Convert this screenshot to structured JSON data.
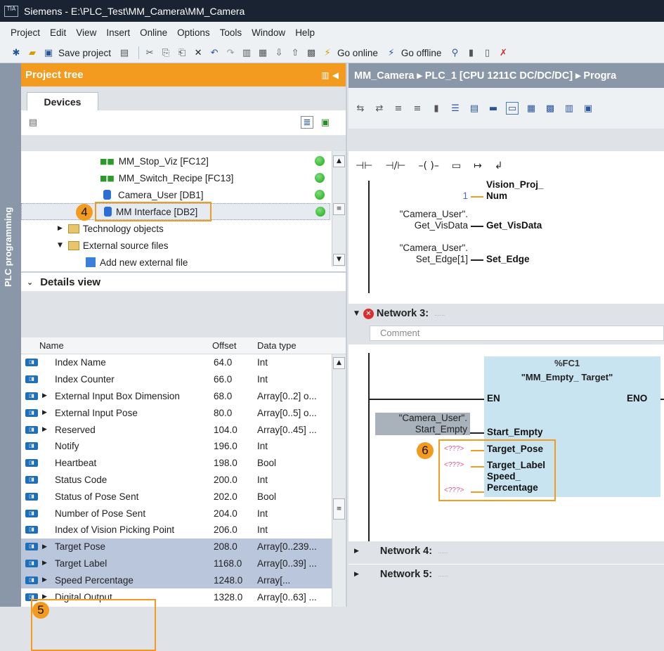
{
  "window": {
    "title": "Siemens - E:\\PLC_Test\\MM_Camera\\MM_Camera",
    "logo": "TIA"
  },
  "menu": [
    "Project",
    "Edit",
    "View",
    "Insert",
    "Online",
    "Options",
    "Tools",
    "Window",
    "Help"
  ],
  "toolbar": {
    "save": "Save project",
    "go_online": "Go online",
    "go_offline": "Go offline"
  },
  "sidebar": {
    "label": "PLC programming"
  },
  "project_tree": {
    "title": "Project tree",
    "tab": "Devices",
    "items": [
      {
        "label": "MM_Stop_Viz [FC12]",
        "icon": "fc-block-icon",
        "status": "green"
      },
      {
        "label": "MM_Switch_Recipe [FC13]",
        "icon": "fc-block-icon",
        "status": "green"
      },
      {
        "label": "Camera_User [DB1]",
        "icon": "db-icon",
        "status": "green"
      },
      {
        "label": "MM Interface [DB2]",
        "icon": "db-icon",
        "status": "green"
      },
      {
        "label": "Technology objects",
        "icon": "folder-icon"
      },
      {
        "label": "External source files",
        "icon": "folder-icon"
      },
      {
        "label": "Add new external file",
        "icon": "add-file-icon"
      }
    ],
    "badge": "4"
  },
  "details_view": {
    "title": "Details view",
    "columns": [
      "Name",
      "Offset",
      "Data type"
    ],
    "rows": [
      {
        "name": "Index Name",
        "offset": "64.0",
        "type": "Int",
        "expand": false,
        "sel": false
      },
      {
        "name": "Index Counter",
        "offset": "66.0",
        "type": "Int",
        "expand": false,
        "sel": false
      },
      {
        "name": "External Input Box Dimension",
        "offset": "68.0",
        "type": "Array[0..2] o...",
        "expand": true,
        "sel": false
      },
      {
        "name": "External Input Pose",
        "offset": "80.0",
        "type": "Array[0..5] o...",
        "expand": true,
        "sel": false
      },
      {
        "name": "Reserved",
        "offset": "104.0",
        "type": "Array[0..45] ...",
        "expand": true,
        "sel": false
      },
      {
        "name": "Notify",
        "offset": "196.0",
        "type": "Int",
        "expand": false,
        "sel": false
      },
      {
        "name": "Heartbeat",
        "offset": "198.0",
        "type": "Bool",
        "expand": false,
        "sel": false
      },
      {
        "name": "Status Code",
        "offset": "200.0",
        "type": "Int",
        "expand": false,
        "sel": false
      },
      {
        "name": "Status of Pose Sent",
        "offset": "202.0",
        "type": "Bool",
        "expand": false,
        "sel": false
      },
      {
        "name": "Number of Pose Sent",
        "offset": "204.0",
        "type": "Int",
        "expand": false,
        "sel": false
      },
      {
        "name": "Index of Vision Picking Point",
        "offset": "206.0",
        "type": "Int",
        "expand": false,
        "sel": false
      },
      {
        "name": "Target Pose",
        "offset": "208.0",
        "type": "Array[0..239...",
        "expand": true,
        "sel": true
      },
      {
        "name": "Target Label",
        "offset": "1168.0",
        "type": "Array[0..39] ...",
        "expand": true,
        "sel": true
      },
      {
        "name": "Speed Percentage",
        "offset": "1248.0",
        "type": "Array[...",
        "expand": true,
        "sel": true
      },
      {
        "name": "Digital Output",
        "offset": "1328.0",
        "type": "Array[0..63] ...",
        "expand": true,
        "sel": false
      }
    ],
    "badge": "5"
  },
  "editor": {
    "breadcrumb": "MM_Camera ▸ PLC_1 [CPU 1211C DC/DC/DC] ▸ Progra",
    "upper": {
      "const_val": "1",
      "pin1a": "Vision_Proj_",
      "pin1b": "Num",
      "tag2a": "\"Camera_User\".",
      "tag2b": "Get_VisData",
      "pin2": "Get_VisData",
      "tag3a": "\"Camera_User\".",
      "tag3b": "Set_Edge[1]",
      "pin3": "Set_Edge"
    },
    "network3": {
      "label": "Network 3:",
      "comment": "Comment",
      "block_no": "%FC1",
      "block_name": "\"MM_Empty_ Target\"",
      "en": "EN",
      "eno": "ENO",
      "tag_a": "\"Camera_User\".",
      "tag_b": "Start_Empty",
      "pin_start": "Start_Empty",
      "pin_pose": "Target_Pose",
      "pin_label": "Target_Label",
      "pin_speed_a": "Speed_",
      "pin_speed_b": "Percentage",
      "placeholder": "<???>",
      "badge": "6"
    },
    "network4": "Network 4:",
    "network5": "Network 5:",
    "net_dots": "......"
  }
}
